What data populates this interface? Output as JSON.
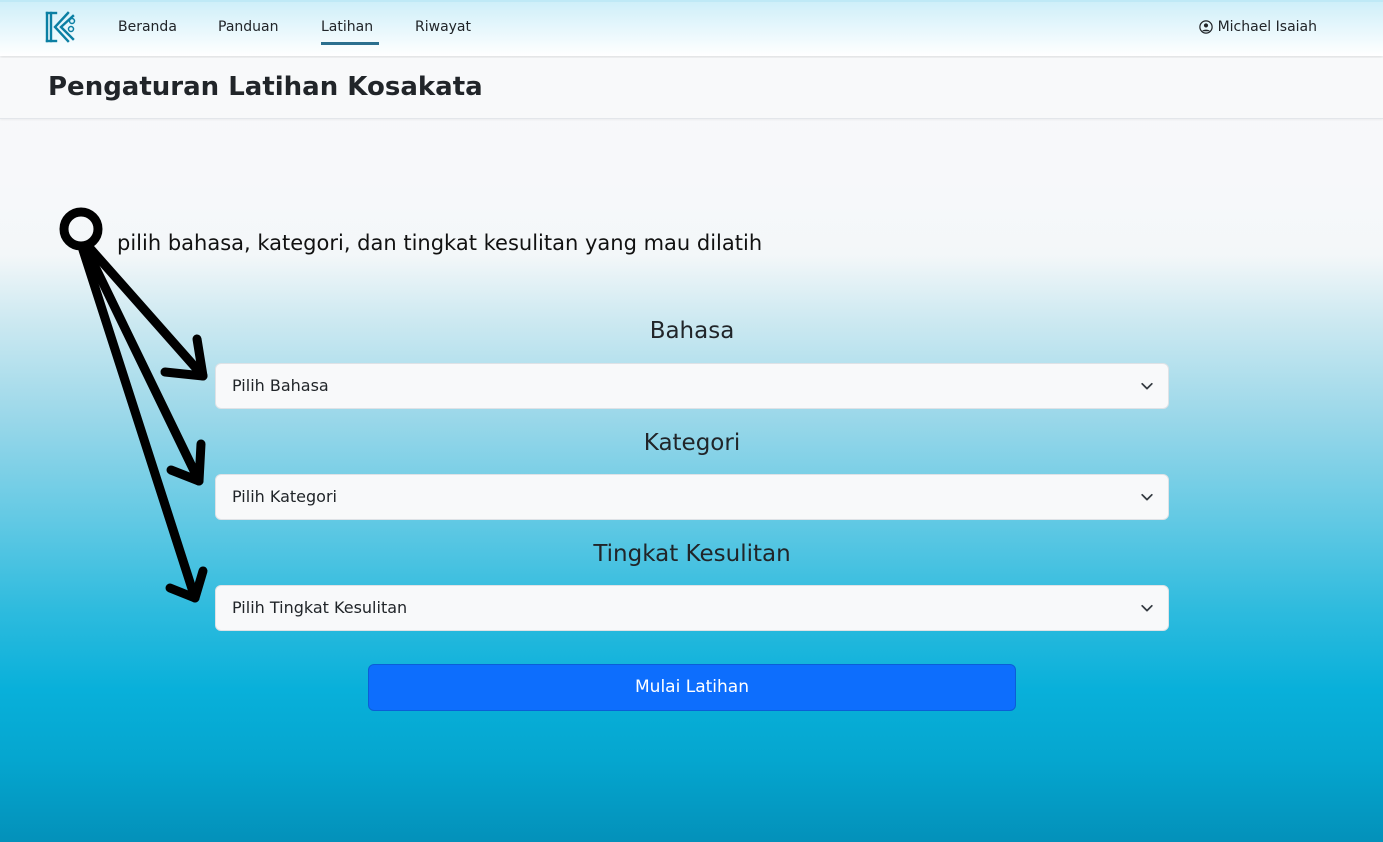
{
  "nav": {
    "links": [
      {
        "label": "Beranda"
      },
      {
        "label": "Panduan"
      },
      {
        "label": "Latihan"
      },
      {
        "label": "Riwayat"
      }
    ],
    "active": "Latihan",
    "user_name": "Michael Isaiah"
  },
  "header": {
    "title": "Pengaturan Latihan Kosakata"
  },
  "annotation": {
    "text": "pilih bahasa, kategori, dan tingkat kesulitan yang mau dilatih"
  },
  "form": {
    "language": {
      "label": "Bahasa",
      "placeholder": "Pilih Bahasa"
    },
    "category": {
      "label": "Kategori",
      "placeholder": "Pilih Kategori"
    },
    "difficulty": {
      "label": "Tingkat Kesulitan",
      "placeholder": "Pilih Tingkat Kesulitan"
    },
    "start_label": "Mulai Latihan"
  },
  "colors": {
    "primary": "#0d6efd",
    "nav_active_underline": "#2b6f8f",
    "brand": "#0b7fa3"
  }
}
